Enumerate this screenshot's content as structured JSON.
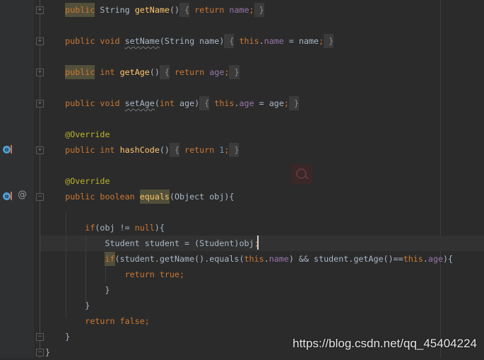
{
  "editor": {
    "lines": [
      {
        "indent": 4,
        "tokens": [
          [
            "public",
            "k hl"
          ],
          [
            " String ",
            "t"
          ],
          [
            "getName",
            "m"
          ],
          [
            "()",
            "t"
          ],
          [
            " {",
            "fold"
          ],
          [
            " return ",
            "k"
          ],
          [
            "name",
            "f"
          ],
          [
            ";",
            "k"
          ],
          [
            " }",
            "fold"
          ]
        ]
      },
      {
        "indent": 0,
        "tokens": []
      },
      {
        "indent": 4,
        "tokens": [
          [
            "public void ",
            "k"
          ],
          [
            "setName",
            "t u"
          ],
          [
            "(String name)",
            "t"
          ],
          [
            " {",
            "fold"
          ],
          [
            " this",
            "k"
          ],
          [
            ".",
            "t"
          ],
          [
            "name",
            "f"
          ],
          [
            " = name",
            "t"
          ],
          [
            ";",
            "k"
          ],
          [
            " }",
            "fold"
          ]
        ]
      },
      {
        "indent": 0,
        "tokens": []
      },
      {
        "indent": 4,
        "tokens": [
          [
            "public",
            "k hl"
          ],
          [
            " int ",
            "k"
          ],
          [
            "getAge",
            "m"
          ],
          [
            "()",
            "t"
          ],
          [
            " {",
            "fold"
          ],
          [
            " return ",
            "k"
          ],
          [
            "age",
            "f"
          ],
          [
            ";",
            "k"
          ],
          [
            " }",
            "fold"
          ]
        ]
      },
      {
        "indent": 0,
        "tokens": []
      },
      {
        "indent": 4,
        "tokens": [
          [
            "public void ",
            "k"
          ],
          [
            "setAge",
            "t u"
          ],
          [
            "(",
            "t"
          ],
          [
            "int ",
            "k"
          ],
          [
            "age)",
            "t"
          ],
          [
            " {",
            "fold"
          ],
          [
            " this",
            "k"
          ],
          [
            ".",
            "t"
          ],
          [
            "age",
            "f"
          ],
          [
            " = age",
            "t"
          ],
          [
            ";",
            "k"
          ],
          [
            " }",
            "fold"
          ]
        ]
      },
      {
        "indent": 0,
        "tokens": []
      },
      {
        "indent": 4,
        "tokens": [
          [
            "@Override",
            "a"
          ]
        ]
      },
      {
        "indent": 4,
        "tokens": [
          [
            "public int ",
            "k"
          ],
          [
            "hashCode",
            "m"
          ],
          [
            "()",
            "t"
          ],
          [
            " {",
            "fold"
          ],
          [
            " return ",
            "k"
          ],
          [
            "1",
            "n"
          ],
          [
            ";",
            "k"
          ],
          [
            " }",
            "fold"
          ]
        ]
      },
      {
        "indent": 0,
        "tokens": []
      },
      {
        "indent": 4,
        "tokens": [
          [
            "@Override",
            "a"
          ]
        ]
      },
      {
        "indent": 4,
        "tokens": [
          [
            "public boolean ",
            "k"
          ],
          [
            "equals",
            "m hl"
          ],
          [
            "(Object obj){",
            "t"
          ]
        ]
      },
      {
        "indent": 0,
        "tokens": []
      },
      {
        "indent": 8,
        "tokens": [
          [
            "if",
            "k"
          ],
          [
            "(obj != ",
            "t"
          ],
          [
            "null",
            "k"
          ],
          [
            "){",
            "t"
          ]
        ]
      },
      {
        "indent": 12,
        "tokens": [
          [
            "Student student = (Student)obj",
            "t"
          ],
          [
            ";",
            "k"
          ]
        ]
      },
      {
        "indent": 12,
        "tokens": [
          [
            "if",
            "k hl"
          ],
          [
            "(student.getName().equals(",
            "t"
          ],
          [
            "this",
            "k"
          ],
          [
            ".",
            "t"
          ],
          [
            "name",
            "f"
          ],
          [
            ") && student.getAge()==",
            "t"
          ],
          [
            "this",
            "k"
          ],
          [
            ".",
            "t"
          ],
          [
            "age",
            "f"
          ],
          [
            "){",
            "t"
          ]
        ]
      },
      {
        "indent": 16,
        "tokens": [
          [
            "return true",
            "k"
          ],
          [
            ";",
            "k"
          ]
        ]
      },
      {
        "indent": 12,
        "tokens": [
          [
            "}",
            "t"
          ]
        ]
      },
      {
        "indent": 8,
        "tokens": [
          [
            "}",
            "t"
          ]
        ]
      },
      {
        "indent": 8,
        "tokens": [
          [
            "return false",
            "k"
          ],
          [
            ";",
            "k"
          ]
        ]
      },
      {
        "indent": 4,
        "tokens": [
          [
            "}",
            "t"
          ]
        ]
      },
      {
        "indent": 0,
        "tokens": [
          [
            "}",
            "t"
          ]
        ]
      }
    ],
    "current_line": 15
  },
  "gutter": {
    "override_icon_glyph": "o",
    "annotation_icon_glyph": "@",
    "fold_plus": "+",
    "fold_minus": "−"
  },
  "watermark": "https://blog.csdn.net/qq_45404224"
}
